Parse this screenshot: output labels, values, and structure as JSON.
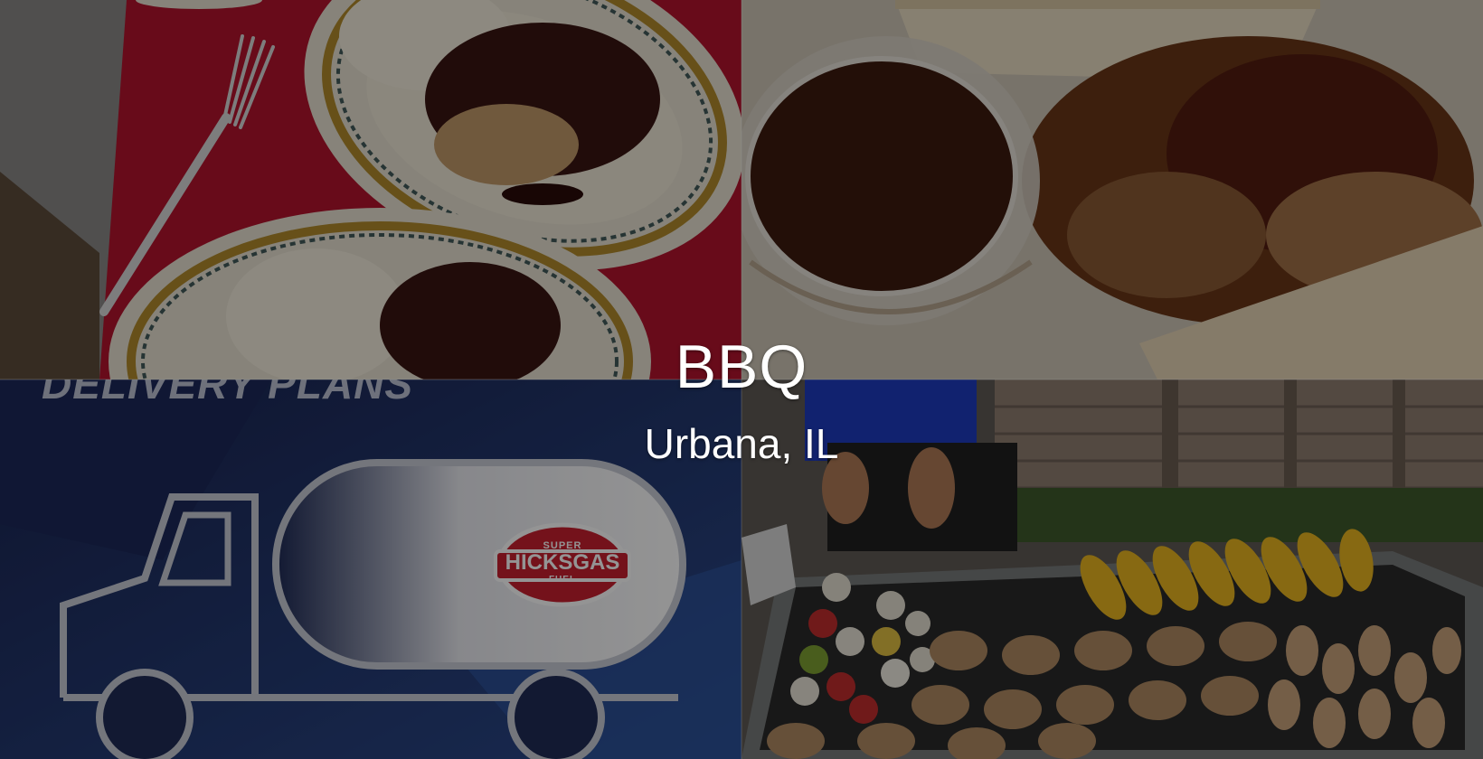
{
  "hero": {
    "title": "BBQ",
    "subtitle": "Urbana, IL"
  },
  "tiles": [
    {
      "name": "pulled-pork-plates-photo"
    },
    {
      "name": "bbq-sandwich-sauce-photo"
    },
    {
      "name": "delivery-plans-promo",
      "heading": "DELIVERY PLANS",
      "logo_top": "SUPER",
      "logo_main": "HICKSGAS",
      "logo_bottom": "FUEL"
    },
    {
      "name": "grill-cookout-photo"
    }
  ],
  "colors": {
    "overlay": "#000000",
    "promo_bg": "#1f2b57",
    "logo_red": "#c8202f",
    "red_placemat": "#b3142e"
  }
}
